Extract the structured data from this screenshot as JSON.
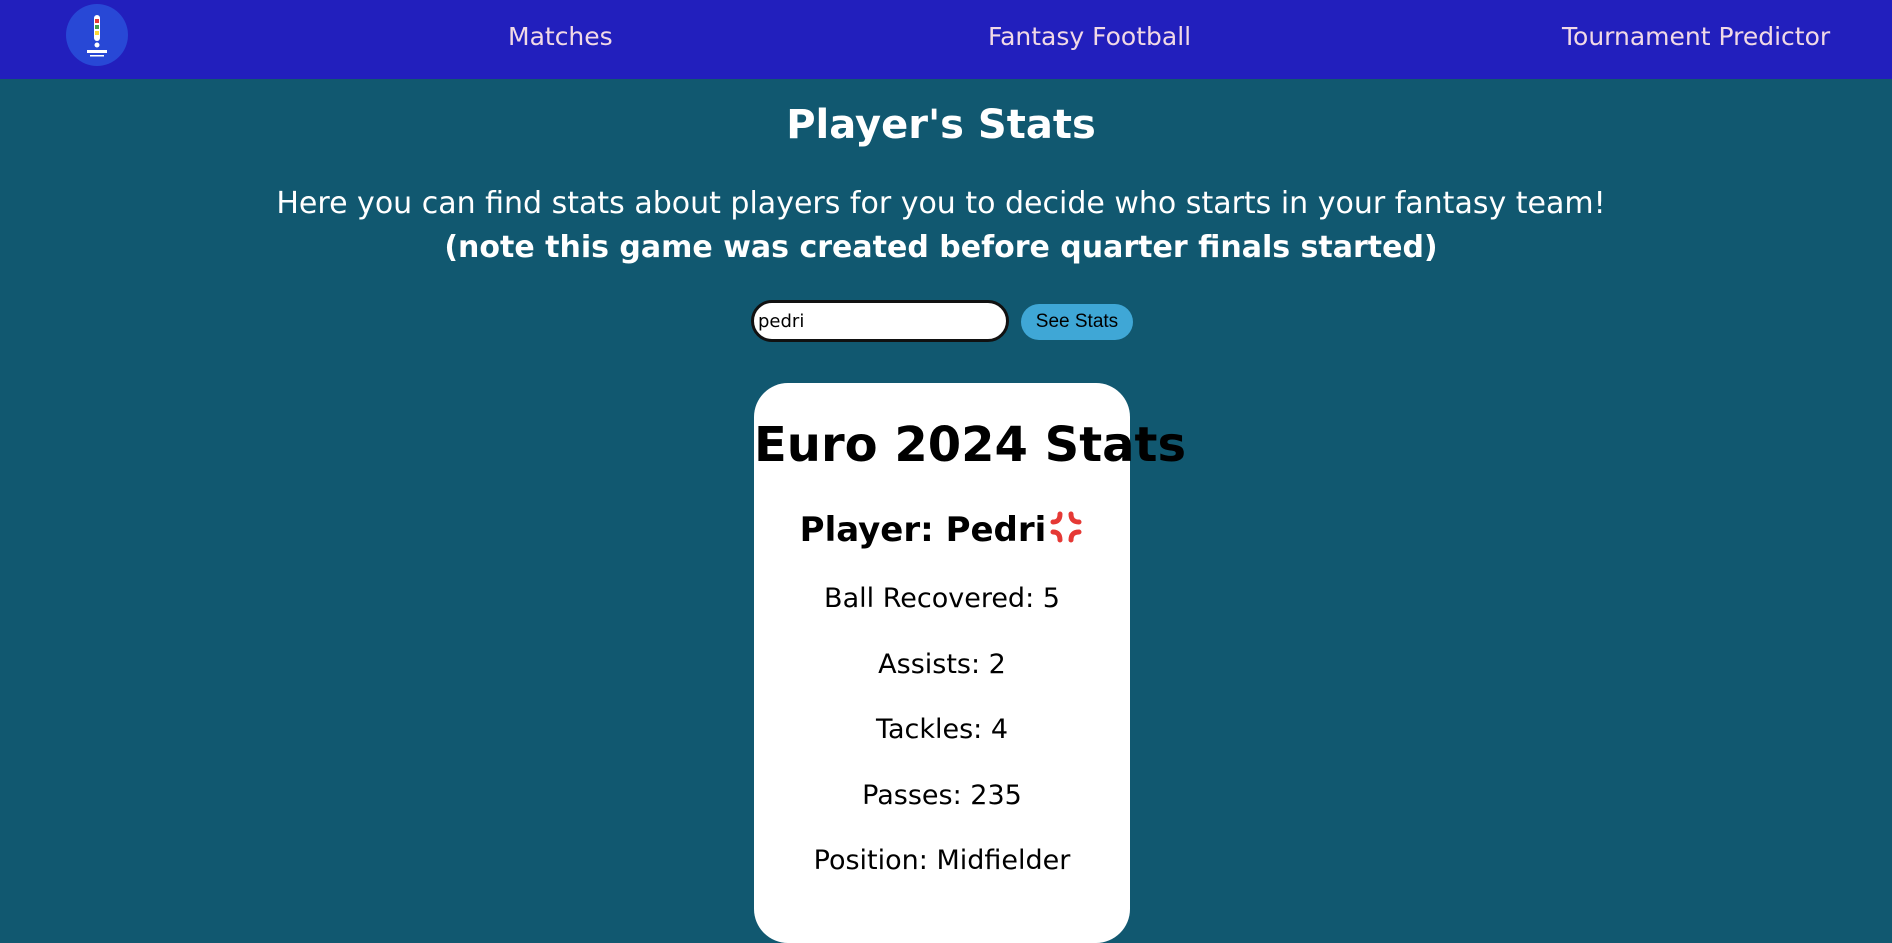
{
  "nav": {
    "links": [
      "Matches",
      "Fantasy Football",
      "Tournament Predictor"
    ]
  },
  "main": {
    "title": "Player's Stats",
    "intro": "Here you can find stats about players for you to decide who starts in your fantasy team!",
    "note": "(note this game was created before quarter finals started)"
  },
  "search": {
    "value": "pedri",
    "button_label": "See Stats"
  },
  "card": {
    "title": "Euro 2024 Stats",
    "player": "Player: Pedri",
    "stats": [
      "Ball Recovered: 5",
      "Assists: 2",
      "Tackles: 4",
      "Passes: 235",
      "Position: Midfielder"
    ]
  },
  "colors": {
    "navbar": "#221fbd",
    "background": "#115870",
    "button": "#3fa7d6",
    "nav_text": "#f1d9e6"
  }
}
